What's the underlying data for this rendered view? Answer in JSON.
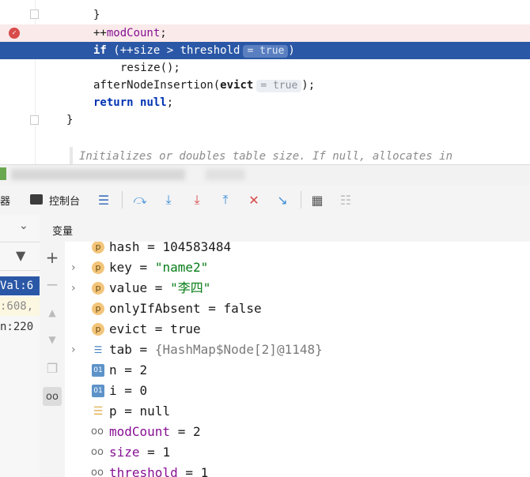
{
  "editor": {
    "lines": [
      {
        "code_parts": [
          "}"
        ],
        "kind": "plain"
      },
      {
        "code_parts": [
          "++modCount;"
        ],
        "kind": "breakpoint"
      },
      {
        "code_parts": [
          "if (++size > threshold",
          "= true",
          ")"
        ],
        "kind": "selected"
      },
      {
        "code_parts": [
          "resize();"
        ],
        "kind": "plain"
      },
      {
        "code_parts": [
          "afterNodeInsertion(evict",
          "= true",
          ");"
        ],
        "kind": "plain"
      },
      {
        "code_parts": [
          "return null;"
        ],
        "kind": "plain"
      },
      {
        "code_parts": [
          "}"
        ],
        "kind": "plain"
      }
    ],
    "doc_comment": "Initializes or doubles table size. If null, allocates in"
  },
  "toolbar": {
    "frames_tab_label": "器",
    "console_tab_label": "控制台",
    "variables_label": "变量"
  },
  "left_panel": {
    "items": [
      "Val:6",
      ":608,",
      "n:220"
    ]
  },
  "variables": [
    {
      "icon": "p",
      "name": "hash",
      "op": " = ",
      "value": "104583484",
      "value_kind": "plain",
      "expandable": false
    },
    {
      "icon": "p",
      "name": "key",
      "op": " = ",
      "value": "\"name2\"",
      "value_kind": "string",
      "expandable": true
    },
    {
      "icon": "p",
      "name": "value",
      "op": " = ",
      "value": "\"李四\"",
      "value_kind": "string",
      "expandable": true
    },
    {
      "icon": "p",
      "name": "onlyIfAbsent",
      "op": " = ",
      "value": "false",
      "value_kind": "plain",
      "expandable": false
    },
    {
      "icon": "p",
      "name": "evict",
      "op": " = ",
      "value": "true",
      "value_kind": "plain",
      "expandable": false
    },
    {
      "icon": "array",
      "name": "tab",
      "op": " = ",
      "value": "{HashMap$Node[2]@1148}",
      "value_kind": "object",
      "expandable": true
    },
    {
      "icon": "01",
      "name": "n",
      "op": " = ",
      "value": "2",
      "value_kind": "plain",
      "expandable": false
    },
    {
      "icon": "01",
      "name": "i",
      "op": " = ",
      "value": "0",
      "value_kind": "plain",
      "expandable": false
    },
    {
      "icon": "ref",
      "name": "p",
      "op": " = ",
      "value": "null",
      "value_kind": "plain",
      "expandable": false
    },
    {
      "icon": "glasses",
      "name": "modCount",
      "op": " = ",
      "value": "2",
      "value_kind": "field",
      "expandable": false
    },
    {
      "icon": "glasses",
      "name": "size",
      "op": " = ",
      "value": "1",
      "value_kind": "field",
      "expandable": false
    },
    {
      "icon": "glasses",
      "name": "threshold",
      "op": " = ",
      "value": "1",
      "value_kind": "field",
      "expandable": false
    }
  ],
  "colors": {
    "selection": "#2b58a6",
    "breakpoint_line": "#faeaea",
    "keyword": "#0033b3",
    "string": "#067d17",
    "field": "#871094"
  }
}
